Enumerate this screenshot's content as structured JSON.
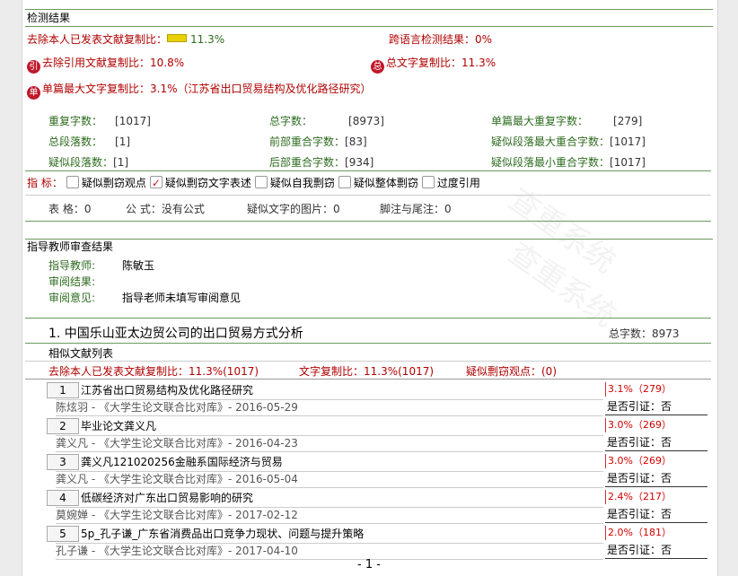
{
  "watermark": "查重系统",
  "result": {
    "title": "检测结果",
    "excl_self_label": "去除本人已发表文献复制比：",
    "excl_self_value": "11.3%",
    "cross_lang_label": "跨语言检测结果：",
    "cross_lang_value": "0%",
    "excl_cite_badge": "引",
    "excl_cite_label": "去除引用文献复制比：",
    "excl_cite_value": "10.8%",
    "total_badge": "总",
    "total_label": "总文字复制比：",
    "total_value": "11.3%",
    "single_badge": "单",
    "single_label": "单篇最大文字复制比：",
    "single_value": "3.1%（江苏省出口贸易结构及优化路径研究）"
  },
  "stats": [
    {
      "label": "重复字数：",
      "value": "[1017]"
    },
    {
      "label": "总字数：",
      "value": "[8973]"
    },
    {
      "label": "单篇最大重复字数：",
      "value": "[279]"
    },
    {
      "label": "总段落数：",
      "value": "[1]"
    },
    {
      "label": "前部重合字数：",
      "value": "[83]"
    },
    {
      "label": "疑似段落最大重合字数：",
      "value": "[1017]"
    },
    {
      "label": "疑似段落数：",
      "value": "[1]"
    },
    {
      "label": "后部重合字数：",
      "value": "[934]"
    },
    {
      "label": "疑似段落最小重合字数：",
      "value": "[1017]"
    }
  ],
  "indicators": {
    "label": "指 标：",
    "items": [
      {
        "text": "疑似剽窃观点",
        "checked": false
      },
      {
        "text": "疑似剽窃文字表述",
        "checked": true
      },
      {
        "text": "疑似自我剽窃",
        "checked": false
      },
      {
        "text": "疑似整体剽窃",
        "checked": false
      },
      {
        "text": "过度引用",
        "checked": false
      }
    ]
  },
  "misc": {
    "tables": "表 格：0",
    "formula": "公 式：没有公式",
    "images": "疑似文字的图片：0",
    "notes": "脚注与尾注：0"
  },
  "review": {
    "title": "指导教师审查结果",
    "teacher_label": "指导教师:",
    "teacher_value": "陈敏玉",
    "result_label": "审阅结果:",
    "opinion_label": "审阅意见:",
    "opinion_value": "指导老师未填写审阅意见"
  },
  "doc": {
    "title": "1. 中国乐山亚太边贸公司的出口贸易方式分析",
    "total_words": "总字数：8973",
    "list_title": "相似文献列表",
    "excl_self": "去除本人已发表文献复制比：11.3%(1017)",
    "text_copy": "文字复制比：11.3%(1017)",
    "plag_points": "疑似剽窃观点：(0)"
  },
  "similar": [
    {
      "idx": "1",
      "title": "江苏省出口贸易结构及优化路径研究",
      "sub": "陈炫羽 - 《大学生论文联合比对库》- 2016-05-29",
      "pct": "3.1%（279）",
      "cite": "是否引证：否"
    },
    {
      "idx": "2",
      "title": "毕业论文龚义凡",
      "sub": "龚义凡 - 《大学生论文联合比对库》- 2016-04-23",
      "pct": "3.0%（269）",
      "cite": "是否引证：否"
    },
    {
      "idx": "3",
      "title": "龚义凡121020256金融系国际经济与贸易",
      "sub": "龚义凡 - 《大学生论文联合比对库》- 2016-05-04",
      "pct": "3.0%（269）",
      "cite": "是否引证：否"
    },
    {
      "idx": "4",
      "title": "低碳经济对广东出口贸易影响的研究",
      "sub": "莫婉婵 - 《大学生论文联合比对库》- 2017-02-12",
      "pct": "2.4%（217）",
      "cite": "是否引证：否"
    },
    {
      "idx": "5",
      "title": "5p_孔子谦_广东省消费品出口竞争力现状、问题与提升策略",
      "sub": "孔子谦 - 《大学生论文联合比对库》- 2017-04-10",
      "pct": "2.0%（181）",
      "cite": "是否引证：否"
    }
  ],
  "footer": {
    "page": "- 1 -"
  }
}
